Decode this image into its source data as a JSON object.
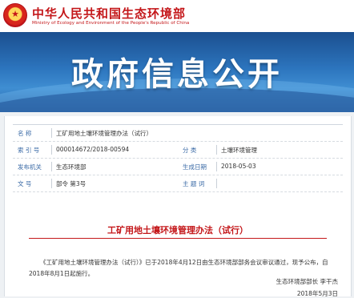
{
  "header": {
    "ministry_cn": "中华人民共和国生态环境部",
    "ministry_en": "Ministry of Ecology and Environment of the People's Republic of China",
    "emblem_icon": "national-emblem-icon"
  },
  "banner": {
    "title": "政府信息公开"
  },
  "meta": {
    "name_label": "名    称",
    "name_value": "工矿用地土壤环境管理办法（试行）",
    "index_label": "索 引 号",
    "index_value": "000014672/2018-00594",
    "category_label": "分    类",
    "category_value": "土壤环境管理",
    "issuer_label": "发布机关",
    "issuer_value": "生态环境部",
    "date_label": "生成日期",
    "date_value": "2018-05-03",
    "docno_label": "文    号",
    "docno_value": "部令 第3号",
    "topic_label": "主 题 词",
    "topic_value": ""
  },
  "document": {
    "title": "工矿用地土壤环境管理办法（试行）",
    "body": "《工矿用地土壤环境管理办法（试行）》已于2018年4月12日由生态环境部部务会议审议通过，现予公布，自2018年8月1日起施行。",
    "signature": "生态环境部部长 李干杰",
    "date": "2018年5月3日"
  },
  "colors": {
    "accent_red": "#c4171a",
    "label_blue": "#3a6aa6",
    "banner_blue": "#2c74bd"
  }
}
